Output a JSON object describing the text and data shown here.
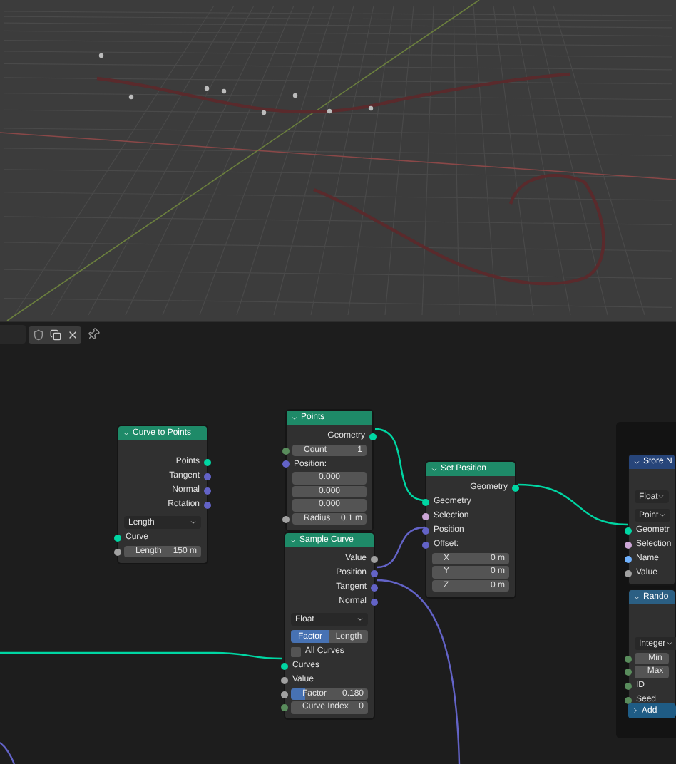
{
  "nodes": [
    {
      "title": "Curve to Points",
      "color": "#1e8a68",
      "rows": [
        {
          "kind": "output",
          "label": "Points",
          "color": "#00d6a3"
        },
        {
          "kind": "output",
          "label": "Tangent",
          "color": "#6363c7"
        },
        {
          "kind": "output",
          "label": "Normal",
          "color": "#6363c7"
        },
        {
          "kind": "output",
          "label": "Rotation",
          "color": "#6363c7"
        },
        {
          "kind": "dropdown",
          "label": "Length"
        },
        {
          "kind": "input",
          "label": "Curve",
          "color": "#00d6a3"
        },
        {
          "kind": "field",
          "label": "Length",
          "value": "150 m",
          "color": "#a1a1a1"
        }
      ]
    },
    {
      "title": "Points",
      "color": "#1e8a68",
      "rows": [
        {
          "kind": "output",
          "label": "Geometry",
          "color": "#00d6a3"
        },
        {
          "kind": "field",
          "label": "Count",
          "value": "1",
          "color": "#598c5c"
        },
        {
          "kind": "input",
          "label": "Position:",
          "color": "#6363c7"
        },
        {
          "kind": "field",
          "value": "0.000"
        },
        {
          "kind": "field",
          "value": "0.000"
        },
        {
          "kind": "field",
          "value": "0.000"
        },
        {
          "kind": "field",
          "label": "Radius",
          "value": "0.1 m",
          "color": "#a1a1a1"
        }
      ]
    },
    {
      "title": "Sample Curve",
      "color": "#1e8a68",
      "rows": [
        {
          "kind": "output",
          "label": "Value",
          "color": "#a1a1a1"
        },
        {
          "kind": "output",
          "label": "Position",
          "color": "#6363c7"
        },
        {
          "kind": "output",
          "label": "Tangent",
          "color": "#6363c7"
        },
        {
          "kind": "output",
          "label": "Normal",
          "color": "#6363c7"
        },
        {
          "kind": "dropdown",
          "label": "Float"
        },
        {
          "kind": "toggle",
          "options": [
            {
              "label": "Factor",
              "selected": true
            },
            {
              "label": "Length",
              "selected": false
            }
          ]
        },
        {
          "kind": "checkbox",
          "label": "All Curves",
          "checked": false
        },
        {
          "kind": "input",
          "label": "Curves",
          "color": "#00d6a3"
        },
        {
          "kind": "input",
          "label": "Value",
          "color": "#a1a1a1"
        },
        {
          "kind": "slider",
          "label": "Factor",
          "value": "0.180",
          "level": 0.18,
          "color": "#a1a1a1"
        },
        {
          "kind": "field",
          "label": "Curve Index",
          "value": "0",
          "color": "#598c5c"
        }
      ]
    },
    {
      "title": "Set Position",
      "color": "#1e8a68",
      "rows": [
        {
          "kind": "output",
          "label": "Geometry",
          "color": "#00d6a3"
        },
        {
          "kind": "input",
          "label": "Geometry",
          "color": "#00d6a3"
        },
        {
          "kind": "input",
          "label": "Selection",
          "color": "#cca6d6"
        },
        {
          "kind": "input",
          "label": "Position",
          "color": "#6363c7"
        },
        {
          "kind": "input",
          "label": "Offset:",
          "color": "#6363c7"
        },
        {
          "kind": "field",
          "label": "X",
          "value": "0 m"
        },
        {
          "kind": "field",
          "label": "Y",
          "value": "0 m"
        },
        {
          "kind": "field",
          "label": "Z",
          "value": "0 m"
        }
      ]
    },
    {
      "title": "Store N",
      "color": "#27457a",
      "rows": [
        {
          "kind": "dropdown",
          "label": "Float"
        },
        {
          "kind": "dropdown",
          "label": "Point"
        },
        {
          "kind": "input",
          "label": "Geometr",
          "color": "#00d6a3"
        },
        {
          "kind": "input",
          "label": "Selection",
          "color": "#cca6d6"
        },
        {
          "kind": "input",
          "label": "Name",
          "color": "#70b2ff"
        },
        {
          "kind": "input",
          "label": "Value",
          "color": "#a1a1a1"
        }
      ]
    },
    {
      "title": "Rando",
      "color": "#2b5f83",
      "rows": [
        {
          "kind": "dropdown",
          "label": "Integer"
        },
        {
          "kind": "field",
          "label": "Min",
          "color": "#598c5c"
        },
        {
          "kind": "field",
          "label": "Max",
          "color": "#598c5c"
        },
        {
          "kind": "input",
          "label": "ID",
          "color": "#598c5c"
        },
        {
          "kind": "input",
          "label": "Seed",
          "color": "#598c5c"
        }
      ]
    }
  ],
  "add_button": {
    "label": "Add"
  }
}
